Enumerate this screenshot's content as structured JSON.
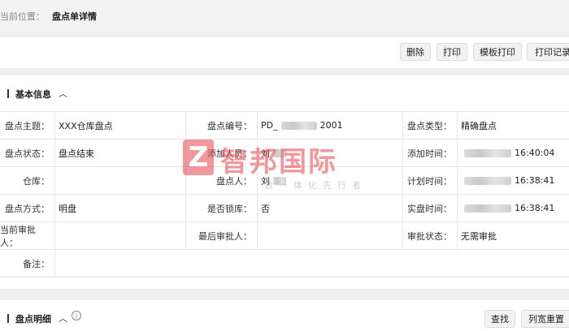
{
  "breadcrumb": {
    "label": "当前位置：",
    "current": "盘点单详情"
  },
  "toolbar": {
    "delete": "删除",
    "print": "打印",
    "template_print": "模板打印",
    "print_log": "打印记录"
  },
  "basic_info": {
    "title": "基本信息",
    "fields": {
      "subject_label": "盘点主题：",
      "subject_value": "XXX仓库盘点",
      "code_label": "盘点编号：",
      "code_prefix": "PD_",
      "code_suffix": "2001",
      "type_label": "盘点类型：",
      "type_value": "精确盘点",
      "status_label": "盘点状态：",
      "status_value": "盘点结束",
      "adder_label": "添加人员：",
      "adder_value": "刘",
      "addtime_label": "添加时间：",
      "addtime_value": "16:40:04",
      "warehouse_label": "仓库：",
      "warehouse_value": "",
      "counter_label": "盘点人：",
      "counter_value": "刘",
      "plantime_label": "计划时间：",
      "plantime_value": "16:38:41",
      "method_label": "盘点方式：",
      "method_value": "明盘",
      "lock_label": "是否锁库：",
      "lock_value": "否",
      "actualtime_label": "实盘时间：",
      "actualtime_value": "16:38:41",
      "cur_approver_label": "当前审批人：",
      "cur_approver_value": "",
      "last_approver_label": "最后审批人：",
      "last_approver_value": "",
      "approve_status_label": "审批状态：",
      "approve_status_value": "无需审批",
      "remark_label": "备注：",
      "remark_value": ""
    }
  },
  "detail": {
    "title": "盘点明细",
    "search": "查找",
    "reset_width": "列宽重置"
  },
  "watermark": {
    "logo": "Z",
    "name": "智邦国际",
    "slogan": "致一体化先行者"
  },
  "colors": {
    "brand": "#e8434c"
  }
}
